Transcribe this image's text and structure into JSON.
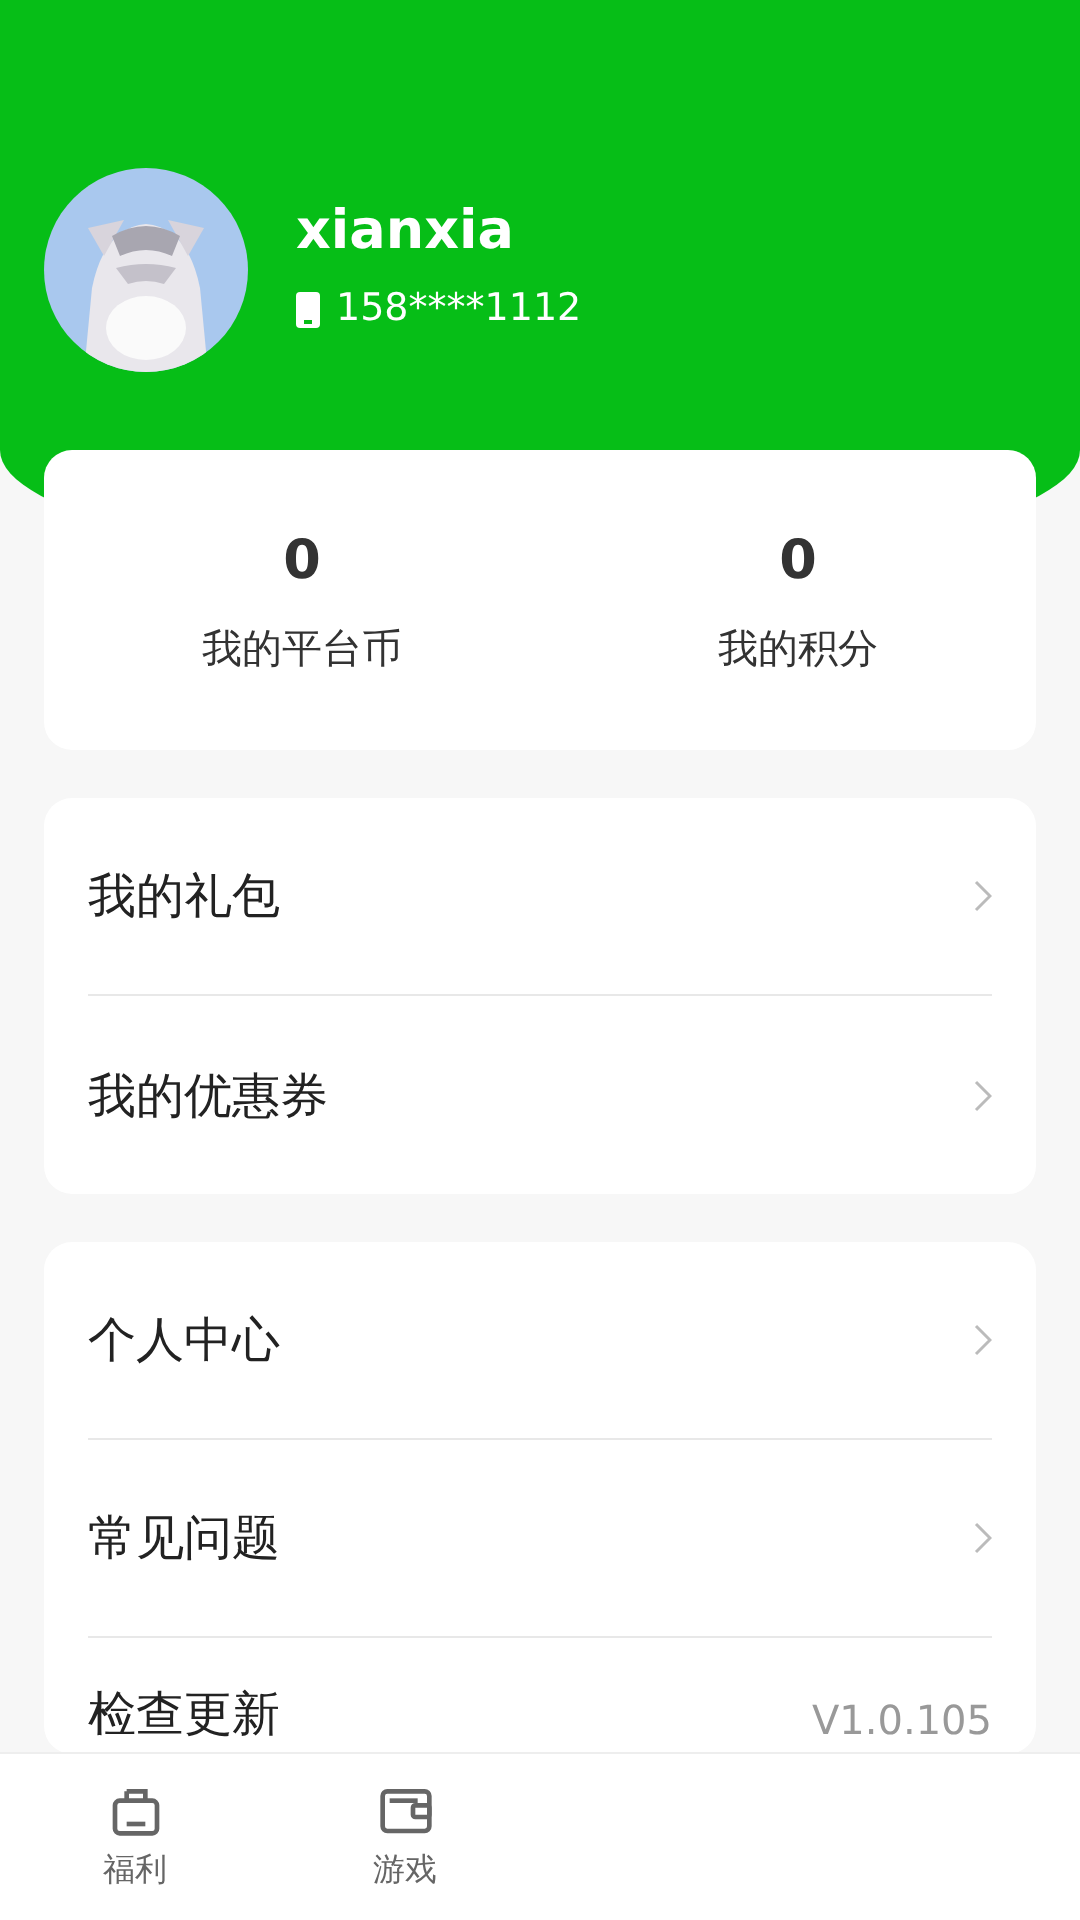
{
  "profile": {
    "username": "xianxia",
    "phone": "158****1112"
  },
  "stats": [
    {
      "value": "0",
      "label": "我的平台币"
    },
    {
      "value": "0",
      "label": "我的积分"
    }
  ],
  "menu_groups": [
    {
      "items": [
        {
          "label": "我的礼包"
        },
        {
          "label": "我的优惠券"
        }
      ]
    },
    {
      "items": [
        {
          "label": "个人中心"
        },
        {
          "label": "常见问题"
        },
        {
          "label": "检查更新",
          "value": "V1.0.105"
        }
      ]
    }
  ],
  "bottom_nav": [
    {
      "kind": "gift",
      "label": "福利",
      "selected": false
    },
    {
      "kind": "wallet",
      "label": "游戏",
      "selected": false
    }
  ]
}
